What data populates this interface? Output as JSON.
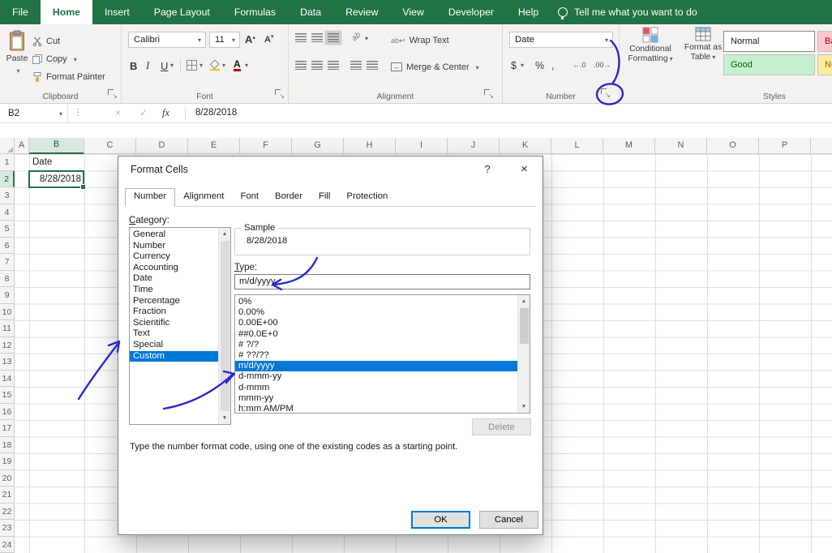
{
  "colors": {
    "excel_green": "#217346",
    "selection_blue": "#0078d7",
    "annotation_ink": "#2727cc",
    "style_bad_bg": "#ffc7ce",
    "style_bad_text": "#9c0006",
    "style_good_bg": "#c6efce",
    "style_good_text": "#006100",
    "style_neutral_bg": "#ffeb9c",
    "style_neutral_text": "#9c6500"
  },
  "ribbon": {
    "active_tab": "Home",
    "tabs": [
      "File",
      "Home",
      "Insert",
      "Page Layout",
      "Formulas",
      "Data",
      "Review",
      "View",
      "Developer",
      "Help"
    ],
    "tell_me": "Tell me what you want to do",
    "groups": {
      "clipboard": {
        "label": "Clipboard",
        "paste": "Paste",
        "cut": "Cut",
        "copy": "Copy",
        "format_painter": "Format Painter"
      },
      "font": {
        "label": "Font",
        "font_name": "Calibri",
        "font_size": "11",
        "bold": "B",
        "italic": "I",
        "underline": "U"
      },
      "alignment": {
        "label": "Alignment",
        "wrap_text": "Wrap Text",
        "merge_center": "Merge & Center"
      },
      "number": {
        "label": "Number",
        "format": "Date",
        "currency": "$",
        "percent": "%",
        "comma": ","
      },
      "styles": {
        "label": "Styles",
        "conditional_formatting": "Conditional Formatting",
        "format_as_table": "Format as Table",
        "style_normal": "Normal",
        "style_bad": "Bad",
        "style_good": "Good",
        "style_neutral": "Neutral"
      }
    }
  },
  "formula_bar": {
    "cell_ref": "B2",
    "value": "8/28/2018",
    "cancel": "×",
    "enter": "✓",
    "fx_label": "fx"
  },
  "grid": {
    "selected_col": "B",
    "selected_row": "2",
    "columns": [
      "A",
      "B",
      "C",
      "D",
      "E",
      "F",
      "G",
      "H",
      "I",
      "J",
      "K",
      "L",
      "M",
      "N",
      "O",
      "P"
    ],
    "rows": [
      "1",
      "2",
      "3",
      "4",
      "5",
      "6",
      "7",
      "8",
      "9",
      "10",
      "11",
      "12",
      "13",
      "14",
      "15",
      "16",
      "17",
      "18",
      "19",
      "20",
      "21",
      "22",
      "23",
      "24"
    ],
    "cells": {
      "B1": "Date",
      "B2": "8/28/2018"
    }
  },
  "dialog": {
    "title": "Format Cells",
    "help_button": "?",
    "close_button": "×",
    "active_tab": "Number",
    "tabs": [
      "Number",
      "Alignment",
      "Font",
      "Border",
      "Fill",
      "Protection"
    ],
    "category_label": "Category:",
    "categories": [
      "General",
      "Number",
      "Currency",
      "Accounting",
      "Date",
      "Time",
      "Percentage",
      "Fraction",
      "Scientific",
      "Text",
      "Special",
      "Custom"
    ],
    "selected_category": "Custom",
    "sample_label": "Sample",
    "sample_value": "8/28/2018",
    "type_label": "Type:",
    "type_value": "m/d/yyyy",
    "type_options": [
      "0%",
      "0.00%",
      "0.00E+00",
      "##0.0E+0",
      "# ?/?",
      "# ??/??",
      "m/d/yyyy",
      "d-mmm-yy",
      "d-mmm",
      "mmm-yy",
      "h:mm AM/PM"
    ],
    "selected_type": "m/d/yyyy",
    "delete_button": "Delete",
    "help_text": "Type the number format code, using one of the existing codes as a starting point.",
    "ok_button": "OK",
    "cancel_button": "Cancel"
  }
}
